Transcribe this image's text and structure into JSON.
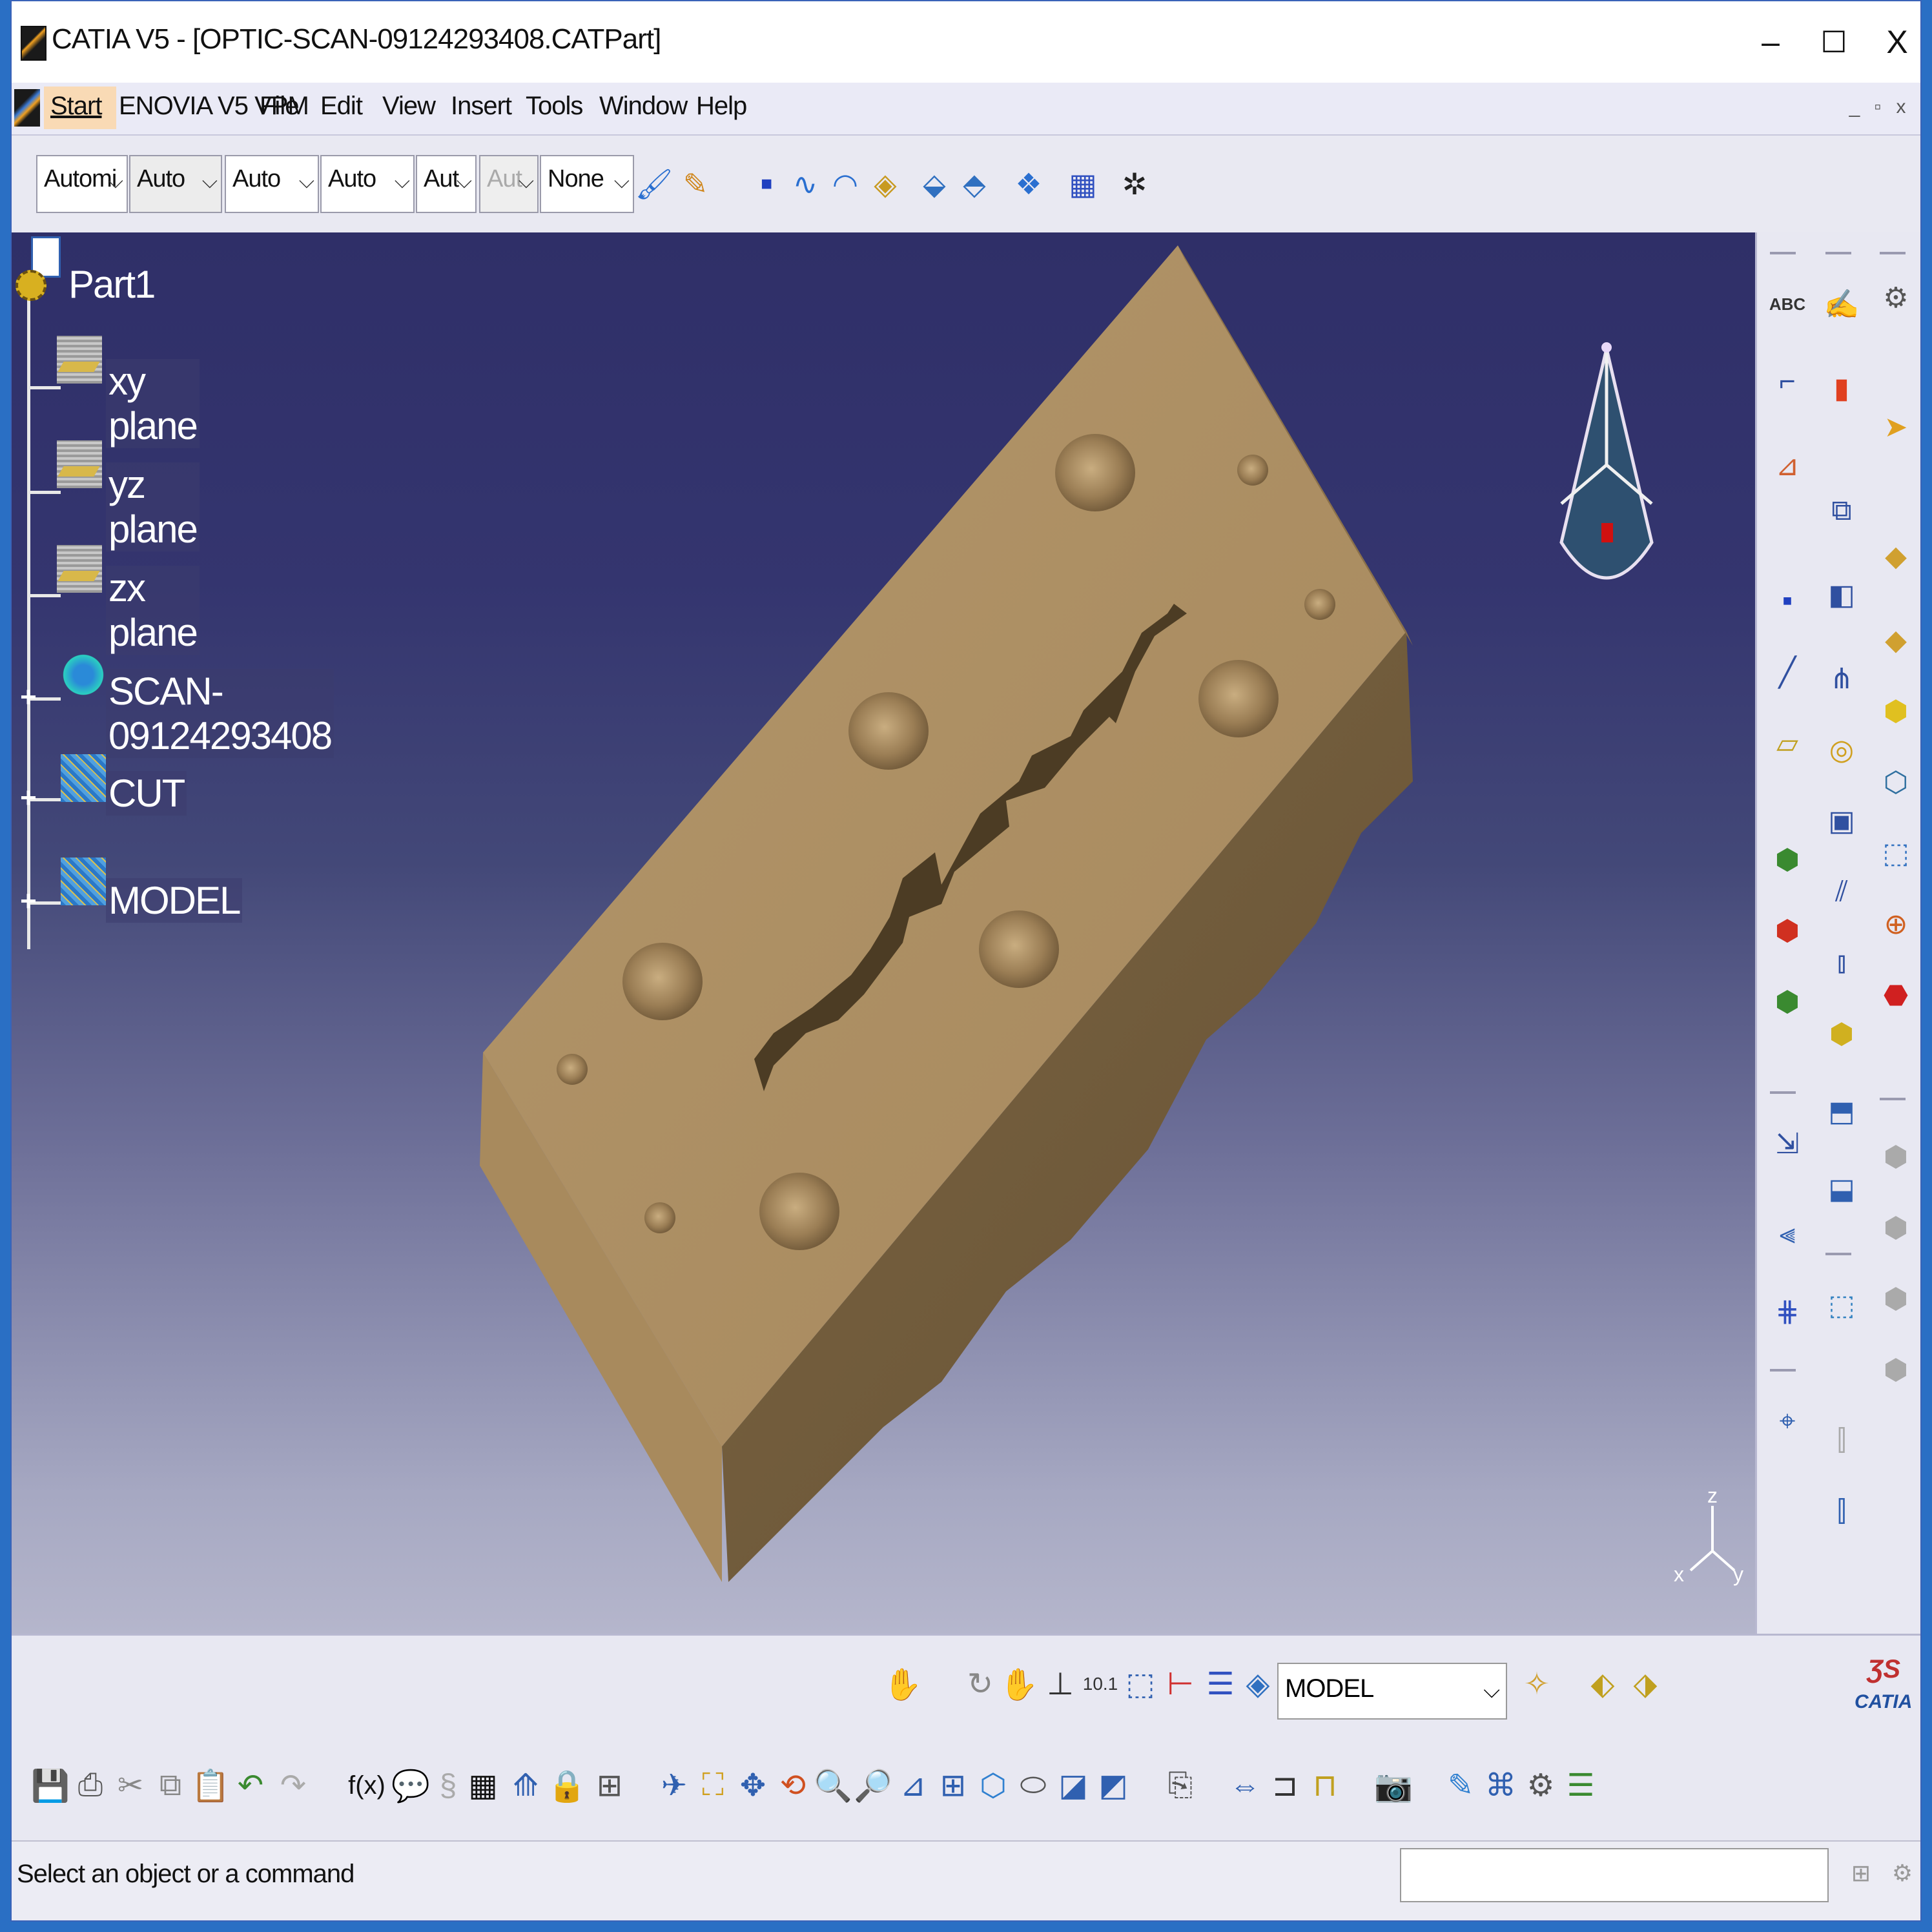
{
  "window": {
    "title": "CATIA V5 - [OPTIC-SCAN-09124293408.CATPart]",
    "minimize": "–",
    "maximize": "☐",
    "close": "X"
  },
  "menubar": {
    "items": [
      "Start",
      "ENOVIA V5 VPM",
      "File",
      "Edit",
      "View",
      "Insert",
      "Tools",
      "Window",
      "Help"
    ],
    "mdi": [
      "_",
      "▫",
      "x"
    ]
  },
  "toolbar": {
    "combos": [
      {
        "value": "Automi",
        "enabled": true
      },
      {
        "value": "Auto",
        "enabled": true
      },
      {
        "value": "Auto",
        "enabled": true
      },
      {
        "value": "Auto",
        "enabled": true
      },
      {
        "value": "Aut",
        "enabled": true
      },
      {
        "value": "Aut",
        "enabled": false
      },
      {
        "value": "None",
        "enabled": true
      }
    ]
  },
  "tree": {
    "root": "Part1",
    "planes": [
      "xy plane",
      "yz plane",
      "zx plane"
    ],
    "bodies": [
      "SCAN-09124293408",
      "CUT",
      "MODEL"
    ]
  },
  "axis": {
    "x": "x",
    "y": "y",
    "z": "z"
  },
  "bottom": {
    "current_body": "MODEL",
    "brand": "CATIA"
  },
  "status": {
    "message": "Select an object or a command"
  },
  "colors": {
    "part": "#ab8d62",
    "part_shadow": "#7a6240",
    "background_top": "#2f2f68",
    "background_bottom": "#b5b6cc"
  }
}
